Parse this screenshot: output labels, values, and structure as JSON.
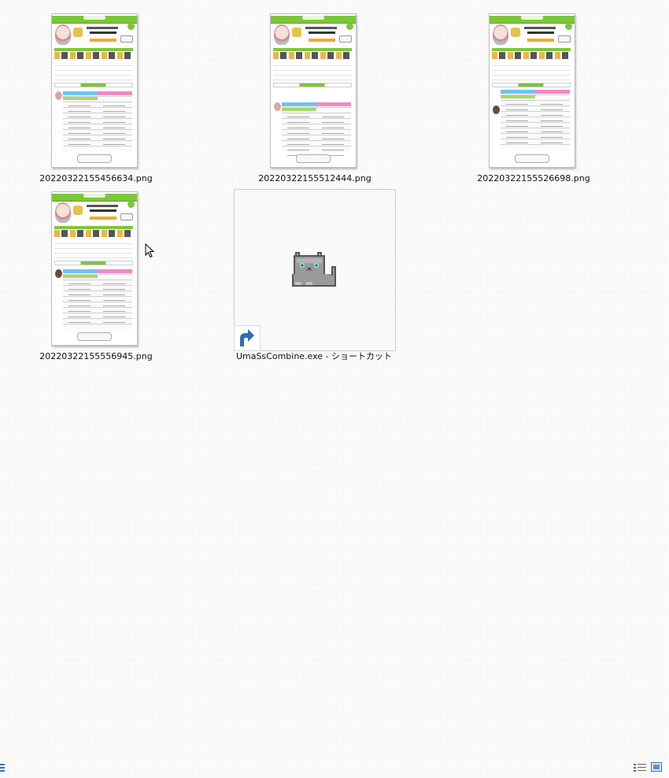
{
  "files": [
    {
      "name": "20220322155456634.png",
      "type": "png-thumbnail"
    },
    {
      "name": "20220322155512444.png",
      "type": "png-thumbnail"
    },
    {
      "name": "20220322155526698.png",
      "type": "png-thumbnail"
    },
    {
      "name": "20220322155556945.png",
      "type": "png-thumbnail"
    },
    {
      "name": "UmaSsCombine.exe - ショートカット",
      "type": "shortcut",
      "icon": "pixel-cat-icon"
    }
  ],
  "colors": {
    "accent_green": "#7cc63b",
    "selection_border": "#c9c9c9",
    "shortcut_arrow": "#2d6db5"
  },
  "statusbar": {
    "icons": [
      "list-view-icon",
      "details-view-icon",
      "large-icons-view-icon"
    ]
  }
}
